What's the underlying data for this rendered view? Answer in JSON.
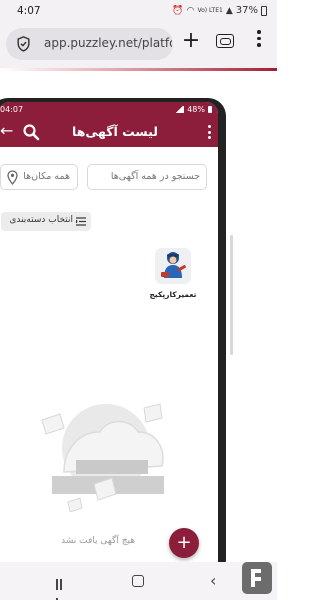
{
  "os_status": {
    "time": "4:07",
    "battery": "37%",
    "network": "Vo) LTE1"
  },
  "browser": {
    "url": "app.puzzley.net/platfo",
    "new_tab_symbol": "+"
  },
  "app": {
    "status_time": "04:07",
    "status_battery": "48%",
    "title": "لیست آگهی‌ها",
    "back_symbol": "←",
    "search_placeholder": "جستجو در همه آگهی‌ها",
    "location_placeholder": "همه مکان‌ها",
    "category_button": "انتخاب دسته‌بندی",
    "categories": [
      {
        "label": "تعمیرکارپکیج",
        "icon": "repairman-icon"
      }
    ],
    "empty_message": "هیچ آگهی یافت نشد",
    "fab_symbol": "+"
  },
  "colors": {
    "primary": "#8c1d3b",
    "chrome": "#f3f1f4"
  },
  "icons": {
    "shield": "shield-icon",
    "tabs": "tab-switcher-icon",
    "menu": "more-vert-icon",
    "search": "search-icon",
    "pin": "location-pin-icon",
    "filter": "filter-list-icon"
  }
}
